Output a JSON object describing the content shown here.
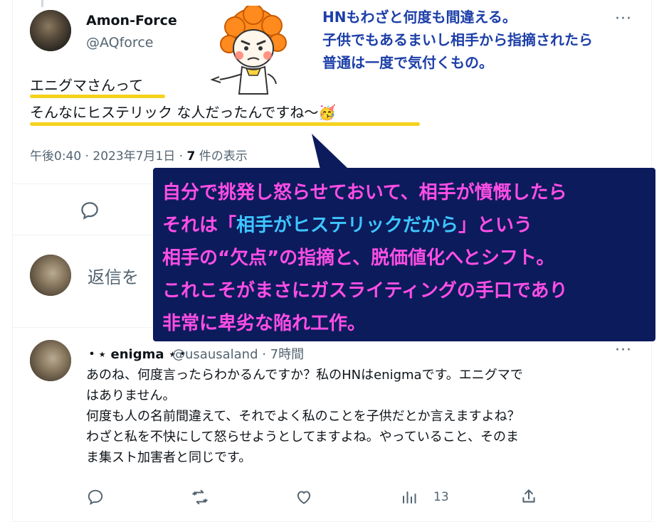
{
  "post": {
    "author_name": "Amon-Force",
    "author_handle": "@AQforce",
    "text_line1": "エニグマさんって",
    "text_line2": "そんなにヒステリック な人だったんですね〜🥳",
    "timestamp": "午後0:40 · 2023年7月1日 · ",
    "views_count": "7",
    "views_label": " 件の表示",
    "more": "···"
  },
  "annotation": {
    "note_lines": [
      "HNもわざと何度も間違える。",
      "子供でもあるまいし相手から指摘されたら",
      "普通は一度で気付くもの。"
    ],
    "box_line1": "自分で挑発し怒らせておいて、相手が憤慨したら",
    "box_line2_a": "それは「",
    "box_line2_hl": "相手がヒステリックだから",
    "box_line2_b": "」という",
    "box_line3": "相手の“欠点”の指摘と、脱価値化へとシフト。",
    "box_line4": "これこそがまさにガスライティングの手口であり",
    "box_line5": "非常に卑劣な陥れ工作。"
  },
  "composer": {
    "placeholder": "返信を"
  },
  "reply": {
    "name": "・⋆ enigma ⋆・",
    "handle": "@usausaland · 7時間",
    "text": [
      "あのね、何度言ったらわかるんですか？私のHNはenigmaです。エニグマで",
      "はありません。",
      "何度も人の名前間違えて、それでよく私のことを子供だとか言えますよね？",
      "わざと私を不快にして怒らせようとしてますよね。やっていること、そのま",
      "ま集スト加害者と同じです。"
    ],
    "more": "···",
    "views": "13"
  },
  "colors": {
    "note_blue": "#1c3ea8",
    "box_navy": "#0c1b5c",
    "box_pink": "#ff4ee6",
    "box_cyan": "#3ec5ff",
    "underline_yellow": "#f5d21c",
    "secondary_text": "#536471"
  }
}
